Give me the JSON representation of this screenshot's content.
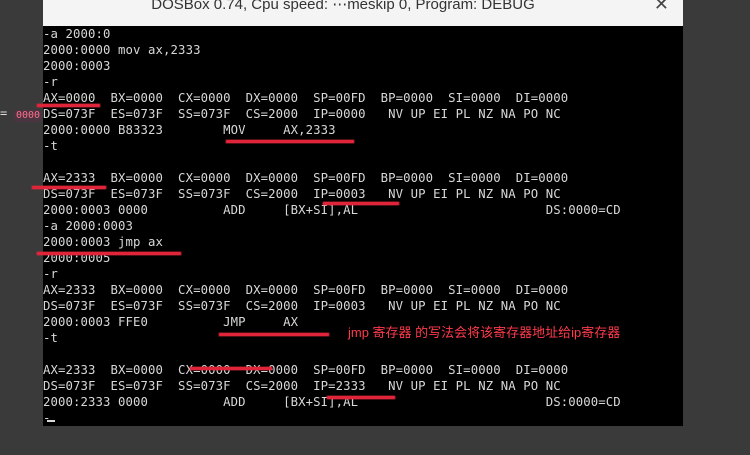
{
  "window": {
    "title": "DOSBox 0.74, Cpu speed: ⋯meskip 0, Program: DEBUG",
    "close_glyph": "✕"
  },
  "side": {
    "eq": "=",
    "badge": "0000"
  },
  "console": {
    "lines": [
      "-a 2000:0",
      "2000:0000 mov ax,2333",
      "2000:0003",
      "-r",
      "AX=0000  BX=0000  CX=0000  DX=0000  SP=00FD  BP=0000  SI=0000  DI=0000",
      "DS=073F  ES=073F  SS=073F  CS=2000  IP=0000   NV UP EI PL NZ NA PO NC",
      "2000:0000 B83323        MOV     AX,2333",
      "-t",
      "",
      "AX=2333  BX=0000  CX=0000  DX=0000  SP=00FD  BP=0000  SI=0000  DI=0000",
      "DS=073F  ES=073F  SS=073F  CS=2000  IP=0003   NV UP EI PL NZ NA PO NC",
      "2000:0003 0000          ADD     [BX+SI],AL                         DS:0000=CD",
      "-a 2000:0003",
      "2000:0003 jmp ax",
      "2000:0005",
      "-r",
      "AX=2333  BX=0000  CX=0000  DX=0000  SP=00FD  BP=0000  SI=0000  DI=0000",
      "DS=073F  ES=073F  SS=073F  CS=2000  IP=0003   NV UP EI PL NZ NA PO NC",
      "2000:0003 FFE0          JMP     AX",
      "-t",
      "",
      "AX=2333  BX=0000  CX=0000  DX=0000  SP=00FD  BP=0000  SI=0000  DI=0000",
      "DS=073F  ES=073F  SS=073F  CS=2000  IP=2333   NV UP EI PL NZ NA PO NC",
      "2000:2333 0000          ADD     [BX+SI],AL                         DS:0000=CD",
      "-"
    ]
  },
  "annotation": {
    "note": "jmp 寄存器    的写法会将该寄存器地址给ip寄存器",
    "color": "#e0253a"
  }
}
